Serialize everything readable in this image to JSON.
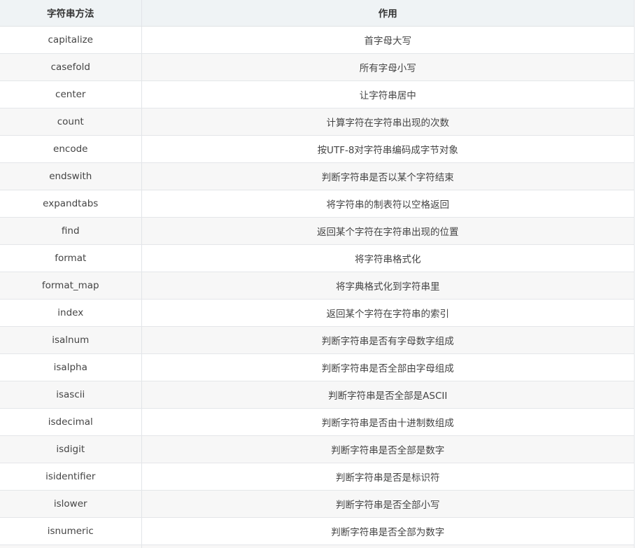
{
  "table": {
    "headers": [
      "字符串方法",
      "作用"
    ],
    "rows": [
      [
        "capitalize",
        "首字母大写"
      ],
      [
        "casefold",
        "所有字母小写"
      ],
      [
        "center",
        "让字符串居中"
      ],
      [
        "count",
        "计算字符在字符串出现的次数"
      ],
      [
        "encode",
        "按UTF-8对字符串编码成字节对象"
      ],
      [
        "endswith",
        "判断字符串是否以某个字符结束"
      ],
      [
        "expandtabs",
        "将字符串的制表符以空格返回"
      ],
      [
        "find",
        "返回某个字符在字符串出现的位置"
      ],
      [
        "format",
        "将字符串格式化"
      ],
      [
        "format_map",
        "将字典格式化到字符串里"
      ],
      [
        "index",
        "返回某个字符在字符串的索引"
      ],
      [
        "isalnum",
        "判断字符串是否有字母数字组成"
      ],
      [
        "isalpha",
        "判断字符串是否全部由字母组成"
      ],
      [
        "isascii",
        "判断字符串是否全部是ASCII"
      ],
      [
        "isdecimal",
        "判断字符串是否由十进制数组成"
      ],
      [
        "isdigit",
        "判断字符串是否全部是数字"
      ],
      [
        "isidentifier",
        "判断字符串是否是标识符"
      ],
      [
        "islower",
        "判断字符串是否全部小写"
      ],
      [
        "isnumeric",
        "判断字符串是否全部为数字"
      ],
      [
        "",
        ""
      ]
    ]
  }
}
